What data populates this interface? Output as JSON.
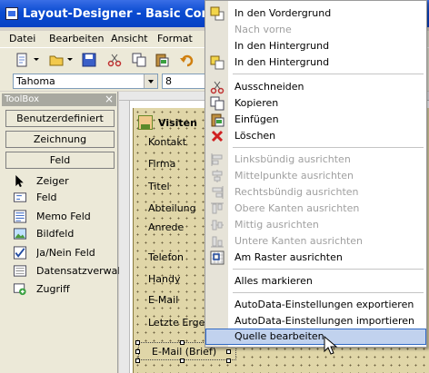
{
  "window": {
    "title": "Layout-Designer - Basic Contact Lay"
  },
  "menubar": {
    "items": [
      "Datei",
      "Bearbeiten",
      "Ansicht",
      "Format"
    ]
  },
  "fontbar": {
    "font": "Tahoma",
    "size": "8"
  },
  "toolbox": {
    "title": "ToolBox",
    "close": "×",
    "categories": [
      "Benutzerdefiniert",
      "Zeichnung",
      "Feld"
    ],
    "items": [
      {
        "label": "Zeiger",
        "icon": "pointer-icon"
      },
      {
        "label": "Feld",
        "icon": "field-icon"
      },
      {
        "label": "Memo Feld",
        "icon": "memo-field-icon"
      },
      {
        "label": "Bildfeld",
        "icon": "image-field-icon"
      },
      {
        "label": "Ja/Nein Feld",
        "icon": "checkbox-field-icon"
      },
      {
        "label": "Datensatzverwaltu",
        "icon": "record-manager-icon"
      },
      {
        "label": "Zugriff",
        "icon": "access-icon"
      }
    ]
  },
  "form": {
    "title": "Visiten",
    "fields": [
      "Kontakt",
      "Firma",
      "Titel",
      "Abteilung",
      "Anrede",
      "Telefon",
      "Handy",
      "E-Mail",
      "Letzte Ergebn"
    ],
    "selected_field": "E-Mail (Brief)"
  },
  "context_menu": {
    "items": [
      {
        "label": "In den Vordergrund",
        "enabled": true
      },
      {
        "label": "Nach vorne",
        "enabled": false
      },
      {
        "label": "In den Hintergrund",
        "enabled": true
      },
      {
        "label": "In den Hintergrund",
        "enabled": true
      },
      {
        "label": "Ausschneiden",
        "enabled": true
      },
      {
        "label": "Kopieren",
        "enabled": true
      },
      {
        "label": "Einfügen",
        "enabled": true
      },
      {
        "label": "Löschen",
        "enabled": true
      },
      {
        "label": "Linksbündig ausrichten",
        "enabled": false
      },
      {
        "label": "Mittelpunkte ausrichten",
        "enabled": false
      },
      {
        "label": "Rechtsbündig ausrichten",
        "enabled": false
      },
      {
        "label": "Obere Kanten ausrichten",
        "enabled": false
      },
      {
        "label": "Mittig ausrichten",
        "enabled": false
      },
      {
        "label": "Untere Kanten ausrichten",
        "enabled": false
      },
      {
        "label": "Am Raster ausrichten",
        "enabled": true
      },
      {
        "label": "Alles markieren",
        "enabled": true
      },
      {
        "label": "AutoData-Einstellungen exportieren",
        "enabled": true
      },
      {
        "label": "AutoData-Einstellungen importieren",
        "enabled": true
      },
      {
        "label": "Quelle bearbeiten",
        "enabled": true,
        "highlighted": true
      }
    ]
  },
  "colors": {
    "titlebar": "#0a4bd1",
    "highlight": "#c1d2ee",
    "form_background": "#e0d6a8"
  }
}
